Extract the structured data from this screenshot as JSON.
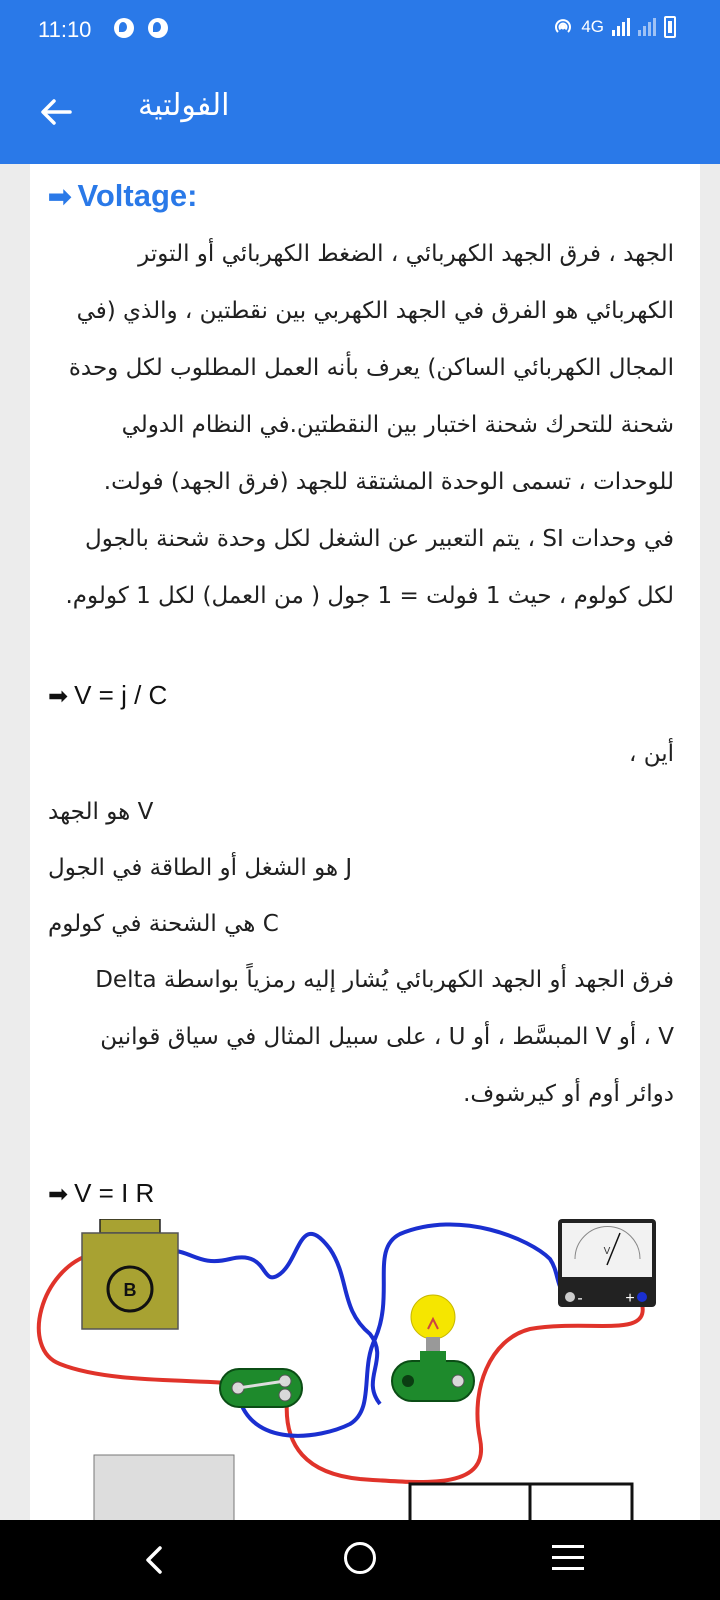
{
  "status": {
    "time": "11:10",
    "network": "4G"
  },
  "appbar": {
    "title": "الفولتية"
  },
  "content": {
    "heading": "Voltage:",
    "para1_lines": [
      "الجهد ، فرق الجهد الكهربائي ، الضغط الكهربائي أو التوتر",
      "الكهربائي هو الفرق في الجهد الكهربي بين نقطتين ، والذي (في",
      "المجال الكهربائي الساكن) يعرف بأنه العمل المطلوب لكل وحدة",
      "شحنة للتحرك شحنة اختبار بين النقطتين.في النظام الدولي",
      "للوحدات ، تسمى الوحدة المشتقة للجهد (فرق الجهد) فولت.",
      "في وحدات SI ، يتم التعبير عن الشغل لكل وحدة شحنة بالجول",
      "لكل كولوم ، حيث 1 فولت = 1 جول ( من العمل) لكل 1 كولوم."
    ],
    "formula1": "V = j / C",
    "where": "أين ،",
    "def_v": "V هو الجهد",
    "def_j": "J هو الشغل أو الطاقة في الجول",
    "def_c": "C هي الشحنة في كولوم",
    "para2_lines": [
      "فرق الجهد أو الجهد الكهربائي يُشار إليه رمزياً بواسطة Delta",
      "V ، أو V المبسَّط ، أو U ، على سبيل المثال في سياق قوانين",
      "دوائر أوم أو كيرشوف."
    ],
    "formula2": "V = I R"
  },
  "diagram": {
    "battery_label": "B",
    "meter_label": "V",
    "meter_minus": "-",
    "meter_plus": "+",
    "wire_colors": {
      "red": "#e0332a",
      "blue": "#1a2fd0"
    },
    "battery_color": "#a8a232"
  }
}
